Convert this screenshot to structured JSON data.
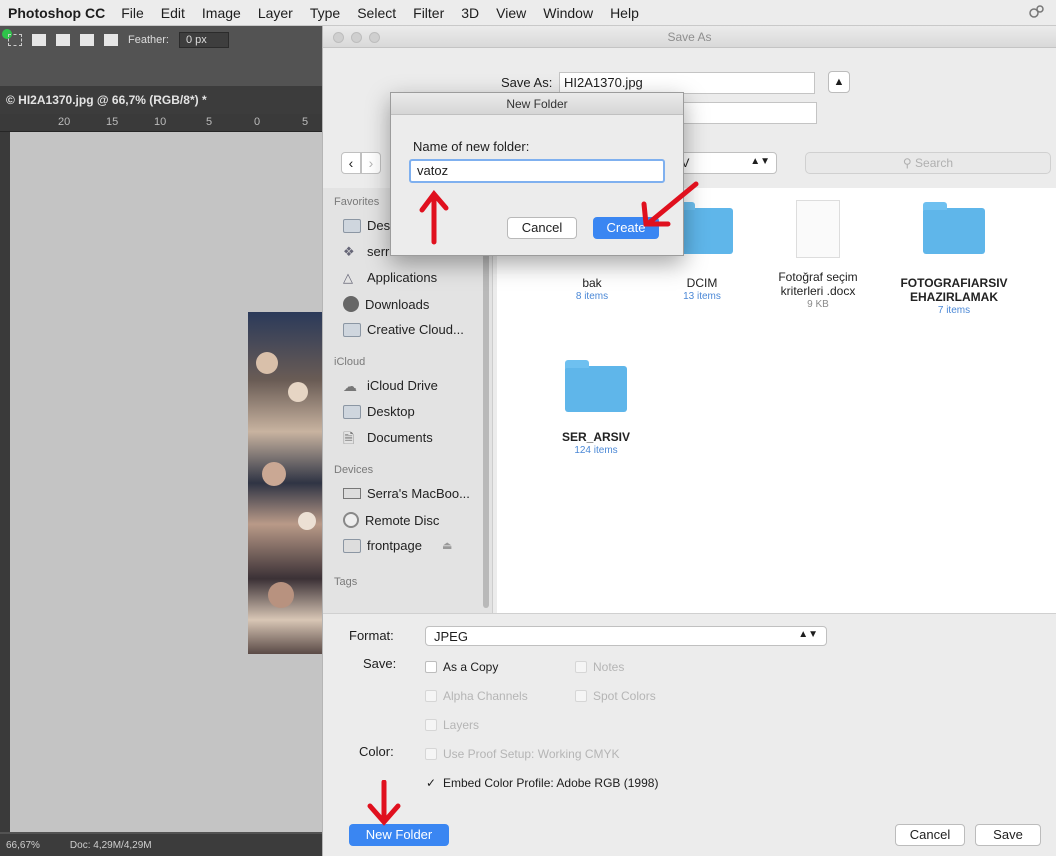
{
  "menubar": {
    "app_name": "Photoshop CC",
    "items": [
      "File",
      "Edit",
      "Image",
      "Layer",
      "Type",
      "Select",
      "Filter",
      "3D",
      "View",
      "Window",
      "Help"
    ]
  },
  "photoshop": {
    "feather_label": "Feather:",
    "feather_value": "0 px",
    "document_tab": "© HI2A1370.jpg @ 66,7% (RGB/8*) *",
    "ruler_ticks": [
      "20",
      "15",
      "10",
      "5",
      "0",
      "5"
    ],
    "zoom": "66,67%",
    "doc_info": "Doc: 4,29M/4,29M"
  },
  "save_dialog": {
    "title": "Save As",
    "save_as_label": "Save As:",
    "filename": "HI2A1370.jpg",
    "location": "SIV",
    "search_placeholder": "Search",
    "sidebar": {
      "favorites_heading": "Favorites",
      "favorites": [
        "Des",
        "serr",
        "Applications",
        "Downloads",
        "Creative Cloud..."
      ],
      "icloud_heading": "iCloud",
      "icloud": [
        "iCloud Drive",
        "Desktop",
        "Documents"
      ],
      "devices_heading": "Devices",
      "devices": [
        "Serra's MacBoo...",
        "Remote Disc",
        "frontpage"
      ],
      "tags_heading": "Tags"
    },
    "files": [
      {
        "name": "bak",
        "meta": "8 items"
      },
      {
        "name": "DCIM",
        "meta": "13 items"
      },
      {
        "name": "Fotoğraf seçim kriterleri .docx",
        "meta": "9 KB"
      },
      {
        "name": "FOTOGRAFIARSIV EHAZIRLAMAK",
        "meta": "7 items"
      },
      {
        "name": "SER_ARSIV",
        "meta": "124 items"
      }
    ],
    "format_label": "Format:",
    "format_value": "JPEG",
    "save_label": "Save:",
    "opt_as_copy": "As a Copy",
    "opt_notes": "Notes",
    "opt_alpha": "Alpha Channels",
    "opt_spot": "Spot Colors",
    "opt_layers": "Layers",
    "color_label": "Color:",
    "opt_proof": "Use Proof Setup:  Working CMYK",
    "opt_embed": "Embed Color Profile:  Adobe RGB (1998)",
    "new_folder_button": "New Folder",
    "cancel_button": "Cancel",
    "save_button": "Save"
  },
  "new_folder_dialog": {
    "title": "New Folder",
    "prompt": "Name of new folder:",
    "input_value": "vatoz",
    "cancel_button": "Cancel",
    "create_button": "Create"
  },
  "colors": {
    "accent_blue": "#3a86f2",
    "folder_blue": "#5fb6ea",
    "annotation_red": "#e0101e"
  }
}
